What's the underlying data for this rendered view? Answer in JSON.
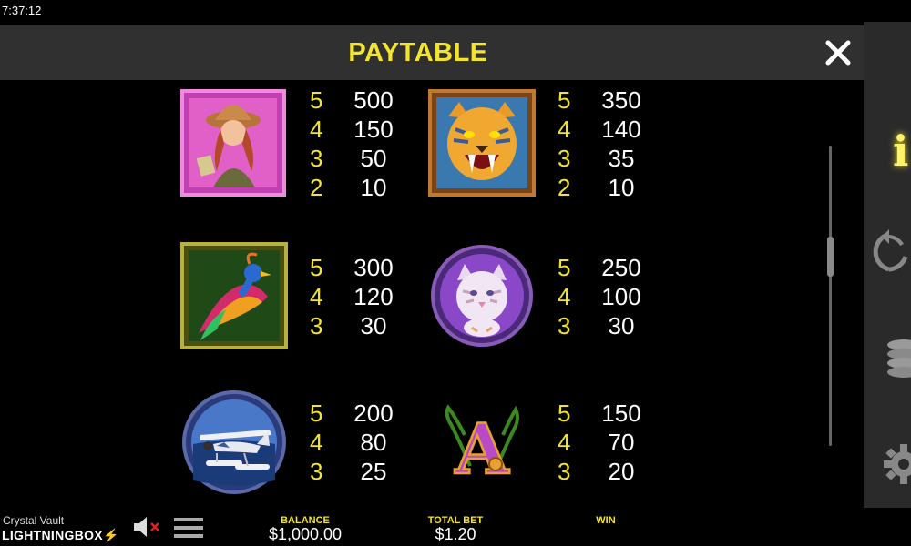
{
  "status_bar": {
    "time": "7:37:12"
  },
  "paytable": {
    "title": "PAYTABLE",
    "symbols": [
      {
        "name": "explorer-woman",
        "pays": [
          {
            "count": "5",
            "value": "500"
          },
          {
            "count": "4",
            "value": "150"
          },
          {
            "count": "3",
            "value": "50"
          },
          {
            "count": "2",
            "value": "10"
          }
        ]
      },
      {
        "name": "tiger",
        "pays": [
          {
            "count": "5",
            "value": "350"
          },
          {
            "count": "4",
            "value": "140"
          },
          {
            "count": "3",
            "value": "35"
          },
          {
            "count": "2",
            "value": "10"
          }
        ]
      },
      {
        "name": "exotic-bird",
        "pays": [
          {
            "count": "5",
            "value": "300"
          },
          {
            "count": "4",
            "value": "120"
          },
          {
            "count": "3",
            "value": "30"
          }
        ]
      },
      {
        "name": "white-tiger-cub",
        "pays": [
          {
            "count": "5",
            "value": "250"
          },
          {
            "count": "4",
            "value": "100"
          },
          {
            "count": "3",
            "value": "30"
          }
        ]
      },
      {
        "name": "seaplane",
        "pays": [
          {
            "count": "5",
            "value": "200"
          },
          {
            "count": "4",
            "value": "80"
          },
          {
            "count": "3",
            "value": "25"
          }
        ]
      },
      {
        "name": "letter-a",
        "letter": "A",
        "pays": [
          {
            "count": "5",
            "value": "150"
          },
          {
            "count": "4",
            "value": "70"
          },
          {
            "count": "3",
            "value": "20"
          }
        ]
      }
    ]
  },
  "sidebar": {
    "items": [
      "info-icon",
      "autoplay-icon",
      "coins-icon",
      "settings-icon"
    ]
  },
  "footer": {
    "game_name": "Crystal Vault",
    "brand_part1": "LIGHTNING",
    "brand_part2": "BOX",
    "balance_label": "BALANCE",
    "balance_value": "$1,000.00",
    "total_bet_label": "TOTAL BET",
    "total_bet_value": "$1.20",
    "win_label": "WIN",
    "win_value": ""
  },
  "colors": {
    "accent": "#f4e42a",
    "header_bg": "#303030",
    "sidebar_bg": "#2a2a2a"
  }
}
